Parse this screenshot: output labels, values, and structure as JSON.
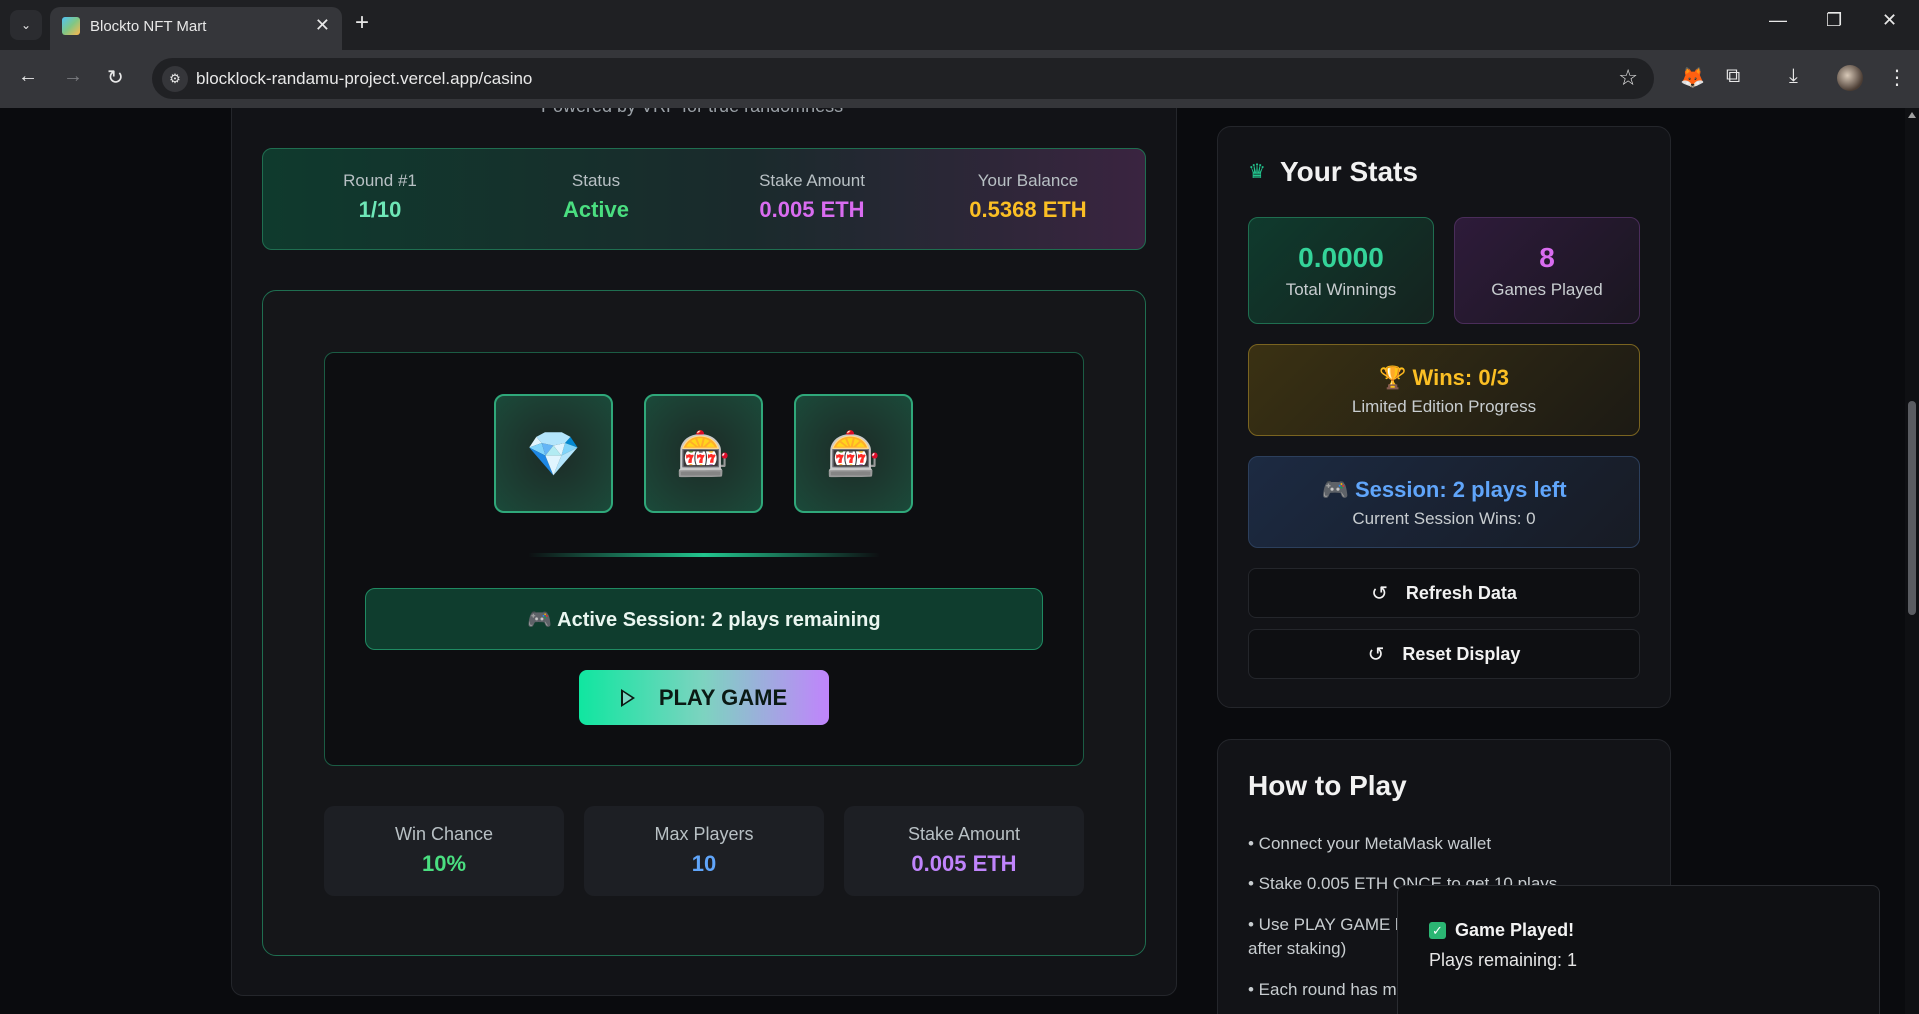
{
  "browser": {
    "tab_title": "Blockto NFT Mart",
    "tab_close": "✕",
    "new_tab": "+",
    "url": "blocklock-randamu-project.vercel.app/casino",
    "win_min": "—",
    "win_restore": "❐",
    "win_close": "✕"
  },
  "header": {
    "powered_by": "Powered by VRF for true randomness"
  },
  "info_strip": {
    "round_label": "Round #1",
    "round_value": "1/10",
    "status_label": "Status",
    "status_value": "Active",
    "stake_label": "Stake Amount",
    "stake_value": "0.005 ETH",
    "balance_label": "Your Balance",
    "balance_value": "0.5368 ETH"
  },
  "reels": {
    "r1": "💎",
    "r2": "🎰",
    "r3": "🎰"
  },
  "game": {
    "session_banner": "🎮 Active Session: 2 plays remaining",
    "play_label": "PLAY GAME"
  },
  "bottom_stats": {
    "win_chance_label": "Win Chance",
    "win_chance_value": "10%",
    "max_players_label": "Max Players",
    "max_players_value": "10",
    "stake_label": "Stake Amount",
    "stake_value": "0.005 ETH"
  },
  "your_stats": {
    "title": "Your Stats",
    "total_winnings_value": "0.0000",
    "total_winnings_label": "Total Winnings",
    "games_played_value": "8",
    "games_played_label": "Games Played",
    "wins_heading": "🏆 Wins: 0/3",
    "wins_sub": "Limited Edition Progress",
    "session_heading": "🎮 Session: 2 plays left",
    "session_sub": "Current Session Wins: 0",
    "refresh_label": "Refresh Data",
    "reset_label": "Reset Display"
  },
  "how_to_play": {
    "title": "How to Play",
    "items": [
      "• Connect your MetaMask wallet",
      "• Stake 0.005 ETH ONCE to get 10 plays",
      "• Use PLAY GAME b",
      "after staking)",
      "• Each round has m"
    ]
  },
  "toast": {
    "title": "Game Played!",
    "body": "Plays remaining: 1"
  },
  "colors": {
    "accent_green": "#22c58e",
    "purple": "#c084fc",
    "yellow": "#fbbf24",
    "blue": "#60a5fa"
  }
}
